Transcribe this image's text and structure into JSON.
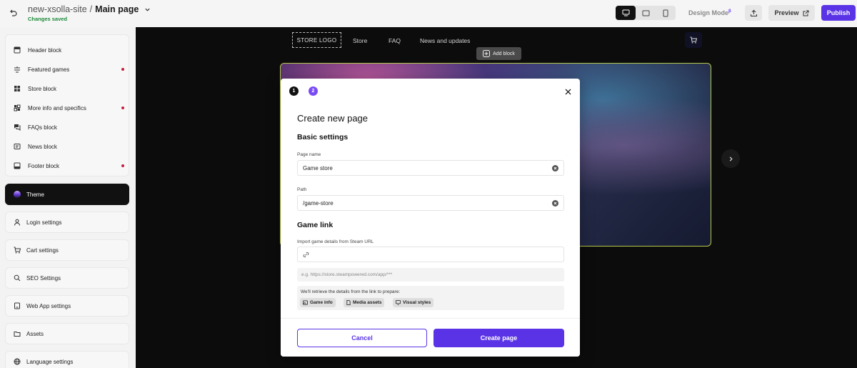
{
  "topbar": {
    "site_name": "new-xsolla-site",
    "separator": "/",
    "page_name": "Main page",
    "status": "Changes saved",
    "design_mode_label": "Design Mode",
    "design_mode_badge": "β",
    "preview_label": "Preview",
    "publish_label": "Publish",
    "devices": [
      "desktop-icon",
      "tablet-icon",
      "mobile-icon"
    ],
    "active_device": "desktop"
  },
  "sidebar": {
    "blocks": [
      {
        "label": "Header block",
        "icon": "header-block-icon",
        "alert": false
      },
      {
        "label": "Featured games",
        "icon": "featured-games-icon",
        "alert": true
      },
      {
        "label": "Store block",
        "icon": "store-block-icon",
        "alert": false
      },
      {
        "label": "More info and specifics",
        "icon": "more-info-icon",
        "alert": true
      },
      {
        "label": "FAQs block",
        "icon": "faqs-block-icon",
        "alert": false
      },
      {
        "label": "News block",
        "icon": "news-block-icon",
        "alert": false
      },
      {
        "label": "Footer block",
        "icon": "footer-block-icon",
        "alert": true
      }
    ],
    "settings": [
      {
        "label": "Theme",
        "icon": "theme-swatch-icon",
        "active": true
      },
      {
        "label": "Login settings",
        "icon": "user-icon"
      },
      {
        "label": "Cart settings",
        "icon": "cart-icon"
      },
      {
        "label": "SEO Settings",
        "icon": "search-icon"
      },
      {
        "label": "Web App settings",
        "icon": "web-app-icon"
      },
      {
        "label": "Assets",
        "icon": "folder-icon"
      },
      {
        "label": "Language settings",
        "icon": "globe-icon"
      }
    ],
    "alert_color": "#c2203e"
  },
  "canvas": {
    "logo_text": "STORE LOGO",
    "nav": [
      "Store",
      "FAQ",
      "News and updates"
    ],
    "add_block_label": "Add block",
    "selection_color": "#b3c94b"
  },
  "modal": {
    "steps": [
      "1",
      "2"
    ],
    "current_step": 2,
    "title": "Create new page",
    "basic_settings_title": "Basic settings",
    "page_name_label": "Page name",
    "page_name_value": "Game store",
    "path_label": "Path",
    "path_value": "/game-store",
    "game_link_title": "Game link",
    "steam_label": "Import game details from Steam URL",
    "steam_value": "",
    "steam_hint": "e.g. https://store.steampowered.com/app/***",
    "info_text": "We'll retrieve the details from the link to prepare:",
    "chips": [
      "Game info",
      "Media assets",
      "Visual styles"
    ],
    "cancel_label": "Cancel",
    "create_label": "Create page",
    "accent_color": "#5a33e6"
  }
}
